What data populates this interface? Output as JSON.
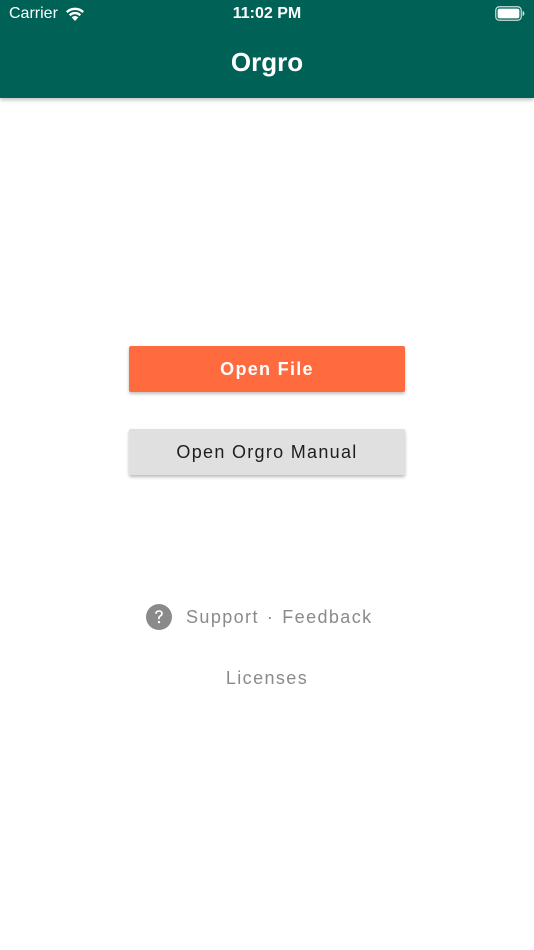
{
  "status_bar": {
    "carrier": "Carrier",
    "time": "11:02 PM",
    "wifi_icon": "wifi-icon",
    "battery_icon": "battery-full-icon"
  },
  "app_bar": {
    "title": "Orgro",
    "color": "#006157"
  },
  "main": {
    "open_file_label": "Open File",
    "open_file_color": "#ff6b3f",
    "open_manual_label": "Open Orgro Manual",
    "open_manual_color": "#e0e0e0"
  },
  "footer": {
    "help_icon": "question-circle-icon",
    "support_label": "Support",
    "separator": "·",
    "feedback_label": "Feedback",
    "licenses_label": "Licenses",
    "text_color": "#8a8a8a"
  }
}
